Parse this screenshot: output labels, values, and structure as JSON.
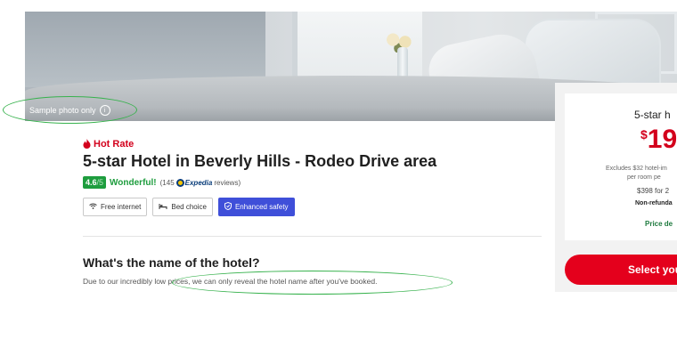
{
  "hero": {
    "sample_label": "Sample photo only",
    "info_icon": "info-circle-icon"
  },
  "listing": {
    "hot_rate": "Hot Rate",
    "hot_rate_icon": "flame-icon",
    "title": "5-star Hotel in Beverly Hills - Rodeo Drive area",
    "rating": {
      "score": "4.6",
      "out_of": "/5",
      "label": "Wonderful!",
      "reviews_prefix": "(145",
      "provider": "Expedia",
      "reviews_suffix": "reviews)"
    },
    "amenities": [
      {
        "label": "Free internet",
        "icon": "wifi-icon"
      },
      {
        "label": "Bed choice",
        "icon": "bed-icon"
      },
      {
        "label": "Enhanced safety",
        "icon": "shield-icon"
      }
    ]
  },
  "hotel_name_section": {
    "title": "What's the name of the hotel?",
    "text": "Due to our incredibly low prices, we can only reveal the hotel name after you've booked."
  },
  "price_panel": {
    "title": "5-star h",
    "currency": "$",
    "price": "19",
    "excludes": "Excludes $32 hotel-im",
    "per_room": "per room pe",
    "total": "$398 for 2",
    "refund": "Non-refunda",
    "price_details": "Price de",
    "select_button": "Select you"
  },
  "colors": {
    "accent_red": "#e4001c",
    "rating_green": "#1e9d3e",
    "safety_blue": "#3f4fd9",
    "annotation_green": "#37b24d"
  }
}
